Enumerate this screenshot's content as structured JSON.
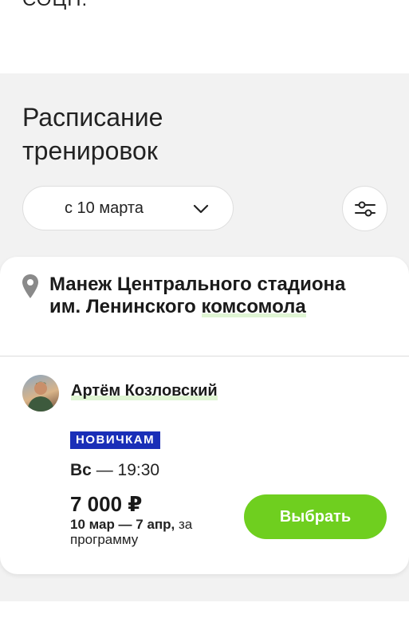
{
  "top_fragment": "СОЦН.",
  "schedule": {
    "title": "Расписание тренировок",
    "date_filter": {
      "value": "с 10 марта",
      "icon": "chevron-down-icon"
    },
    "filter_icon": "sliders-icon"
  },
  "card": {
    "venue": {
      "name_part1": "Манеж Центрального стадиона им. Ленинского ",
      "name_part2": "комсомола",
      "icon": "location-pin-icon"
    },
    "trainer": {
      "name": "Артём Козловский"
    },
    "level_badge": "НОВИЧКАМ",
    "day": "Вс",
    "time_sep": " — ",
    "time": "19:30",
    "price": "7 000 ₽",
    "period_dates": "10 мар — 7 апр,",
    "period_suffix": " за программу",
    "choose_label": "Выбрать"
  },
  "colors": {
    "accent_green": "#6fcf1f",
    "badge_blue": "#1a2fb8",
    "highlight_green": "#dff5d3",
    "section_bg": "#f2f2f2"
  }
}
